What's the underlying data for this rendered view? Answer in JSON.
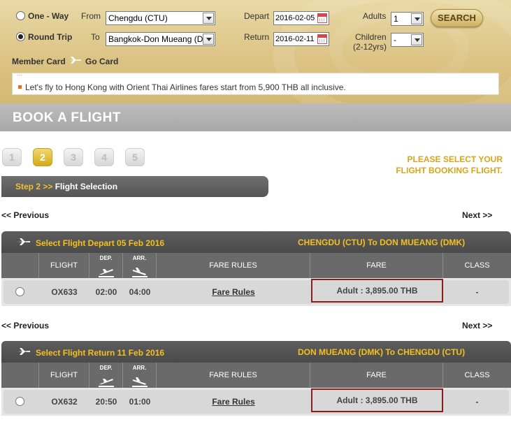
{
  "search": {
    "trip_one_way": "One - Way",
    "trip_round": "Round Trip",
    "from_label": "From",
    "from_value": "Chengdu (CTU)",
    "to_label": "To",
    "to_value": "Bangkok-Don Mueang (D",
    "depart_label": "Depart",
    "depart_value": "2016-02-05",
    "return_label": "Return",
    "return_value": "2016-02-11",
    "adults_label": "Adults",
    "adults_value": "1",
    "children_label": "Children",
    "children_sub": "(2-12yrs)",
    "children_value": "-",
    "search_button": "SEARCH",
    "member_card": "Member Card",
    "go_card": "Go Card"
  },
  "news": {
    "text": "Let's fly to Hong Kong with Orient Thai Airlines fares start from 5,900 THB all inclusive."
  },
  "book": {
    "title": "BOOK A FLIGHT"
  },
  "steps": [
    "1",
    "2",
    "3",
    "4",
    "5"
  ],
  "notice": {
    "line1": "PLEASE SELECT YOUR",
    "line2": "FLIGHT BOOKING FLIGHT."
  },
  "crumb": {
    "step": "Step 2 >>",
    "label": "Flight Selection"
  },
  "nav": {
    "prev": "<< Previous",
    "next": "Next >>"
  },
  "columns": {
    "flight": "FLIGHT",
    "dep": "DEP.",
    "arr": "ARR.",
    "fare_rules": "FARE RULES",
    "fare": "FARE",
    "class": "CLASS"
  },
  "depart": {
    "title": "Select Flight Depart 05 Feb 2016",
    "route": "CHENGDU (CTU) To DON MUEANG (DMK)",
    "flight": "OX633",
    "dep": "02:00",
    "arr": "04:00",
    "fare_rules": "Fare Rules",
    "fare": "Adult : 3,895.00 THB",
    "class": "-"
  },
  "return": {
    "title": "Select Flight Return 11 Feb 2016",
    "route": "DON MUEANG (DMK) To CHENGDU (CTU)",
    "flight": "OX632",
    "dep": "20:50",
    "arr": "01:00",
    "fare_rules": "Fare Rules",
    "fare": "Adult : 3,895.00 THB",
    "class": "-"
  },
  "colors": {
    "accent": "#f4c020",
    "fare_border": "#8a1e1e",
    "header_dark": "#555555"
  }
}
